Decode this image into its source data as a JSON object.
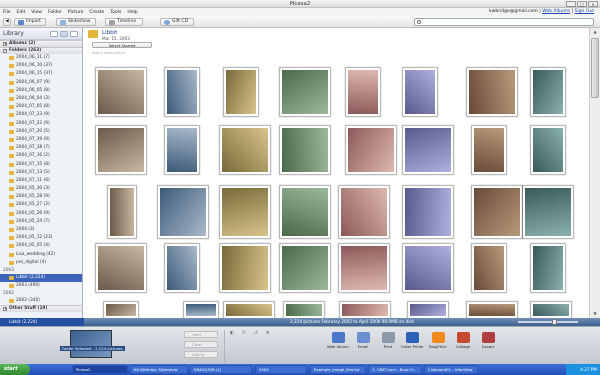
{
  "window": {
    "title": "Picasa2"
  },
  "menu": {
    "items": [
      "File",
      "Edit",
      "View",
      "Folder",
      "Picture",
      "Create",
      "Tools",
      "Help"
    ],
    "account_email": "kwbridge@gmail.com",
    "web_albums_link": "Web Albums",
    "sign_out_link": "Sign Out"
  },
  "toolbar": {
    "import_label": "Import",
    "slideshow_label": "Slideshow",
    "timeline_label": "Timeline",
    "giftcd_label": "Gift CD",
    "search_placeholder": ""
  },
  "sidebar": {
    "title": "Library",
    "albums_label": "Albums (2)",
    "folders_label": "Folders (263)",
    "folders": [
      "2004_06_11 (7)",
      "2004_06_10 (37)",
      "2004_06_15 (37)",
      "2004_06_07 (9)",
      "2004_06_05 (8)",
      "2004_06_04 (3)",
      "2004_07_05 (8)",
      "2004_07_23 (9)",
      "2004_07_22 (9)",
      "2004_07_20 (5)",
      "2004_07_19 (9)",
      "2004_07_18 (7)",
      "2004_07_16 (2)",
      "2004_07_15 (8)",
      "2004_07_13 (5)",
      "2004_07_11 (6)",
      "2004_05_30 (3)",
      "2004_05_28 (9)",
      "2004_05_27 (2)",
      "2004_05_26 (9)",
      "2004_05_24 (7)",
      "2004 (3)",
      "2004_05_12 (23)",
      "2004_05_05 (4)",
      "Lisa_wedding (42)",
      "pre_digital (4)"
    ],
    "year_2003": "2003",
    "selected_folder": "Libbit (2,224)",
    "after_folder": "2003 (490)",
    "year_2002": "2002",
    "folder_2002": "2002 (340)",
    "other_stuff_label": "Other Stuff (19)"
  },
  "album": {
    "name": "Libbit",
    "date": "Mar 15, 2003",
    "select_starred": "Select Starred",
    "add_description": "Add a description"
  },
  "status": {
    "text": "2,224 pictures   February 2002 to April 2006   98.9MB on disk",
    "selection_count": "Libbit (2,224)"
  },
  "tray": {
    "selection_label": "Folder Selected - 2,224 pictures",
    "hold_label": "Hold",
    "clear_label": "Clear",
    "add_to_label": "Add to",
    "actions": [
      "Web Album",
      "Email",
      "Print",
      "Order Prints",
      "BlogThis!",
      "Collage",
      "Export"
    ],
    "action_colors": [
      "#4a78c8",
      "#6a8fd0",
      "#8a9aa8",
      "#2e62b8",
      "#f08a1c",
      "#c84a2e",
      "#b04040"
    ]
  },
  "taskbar": {
    "start_label": "start",
    "tasks": [
      "Picasa2",
      "Kit Birthday: Slideshow",
      "KB4SQ7D8 (1)",
      "2004",
      "Example_image_flea.txt",
      "1. CNET.com - Buzz O...",
      "Clipboard01 - IrfanView"
    ],
    "clock": "4:27 PM"
  }
}
